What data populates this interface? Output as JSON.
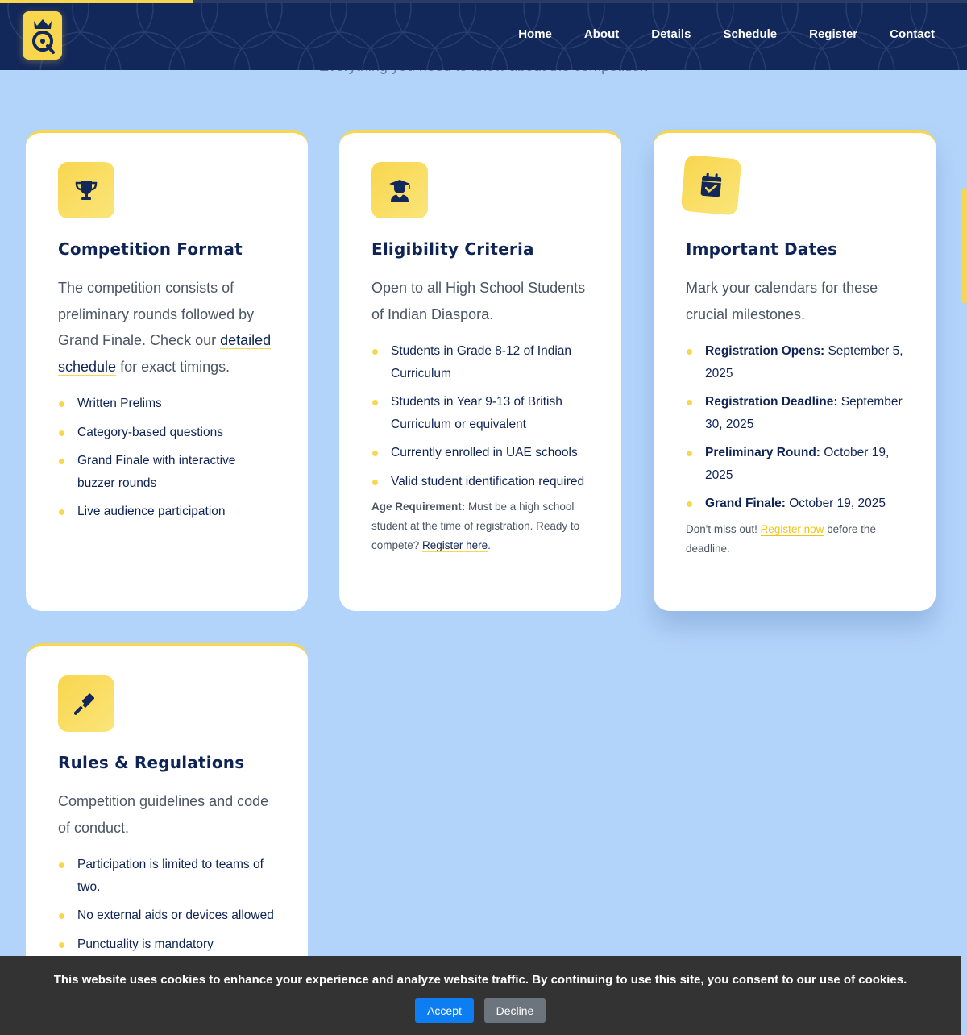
{
  "header": {
    "logo_icon": "quiz-crown-logo",
    "nav": [
      {
        "label": "Home"
      },
      {
        "label": "About"
      },
      {
        "label": "Details"
      },
      {
        "label": "Schedule"
      },
      {
        "label": "Register"
      },
      {
        "label": "Contact"
      }
    ]
  },
  "section": {
    "subtitle": "Everything you need to know about the competition"
  },
  "cards": [
    {
      "icon": "trophy-icon",
      "title": "Competition Format",
      "desc_before": "The competition consists of preliminary rounds followed by Grand Finale. Check our ",
      "desc_link": "detailed schedule",
      "desc_after": " for exact timings.",
      "points": [
        "Written Prelims",
        "Category-based questions",
        "Grand Finale with interactive buzzer rounds",
        "Live audience participation"
      ]
    },
    {
      "icon": "graduate-icon",
      "title": "Eligibility Criteria",
      "desc": "Open to all High School Students of Indian Diaspora.",
      "points": [
        "Students in Grade 8-12 of Indian Curriculum",
        "Students in Year 9-13 of British Curriculum or equivalent",
        "Currently enrolled in UAE schools",
        "Valid student identification required"
      ],
      "note_label": "Age Requirement:",
      "note_text": " Must be a high school student at the time of registration. Ready to compete? ",
      "note_link": "Register here",
      "note_end": "."
    },
    {
      "icon": "calendar-check-icon",
      "title": "Important Dates",
      "desc": "Mark your calendars for these crucial milestones.",
      "dates": [
        {
          "label": "Registration Opens:",
          "value": " September 5, 2025"
        },
        {
          "label": "Registration Deadline:",
          "value": " September 30, 2025"
        },
        {
          "label": "Preliminary Round:",
          "value": " October 19, 2025"
        },
        {
          "label": "Grand Finale:",
          "value": " October 19, 2025"
        }
      ],
      "note_text": "Don't miss out! ",
      "note_link": "Register now",
      "note_end": " before the deadline."
    },
    {
      "icon": "gavel-icon",
      "title": "Rules & Regulations",
      "desc": "Competition guidelines and code of conduct.",
      "points": [
        "Participation is limited to teams of two.",
        "No external aids or devices allowed",
        "Punctuality is mandatory"
      ]
    }
  ],
  "cookie": {
    "text": "This website uses cookies to enhance your experience and analyze website traffic. By continuing to use this site, you consent to our use of cookies.",
    "accept": "Accept",
    "decline": "Decline"
  },
  "colors": {
    "accent": "#f8d64e",
    "navy": "#0f2456",
    "background": "#b3d4fa",
    "accept": "#0d7df2",
    "decline": "#6c757d"
  },
  "scroll_progress": 0.2
}
